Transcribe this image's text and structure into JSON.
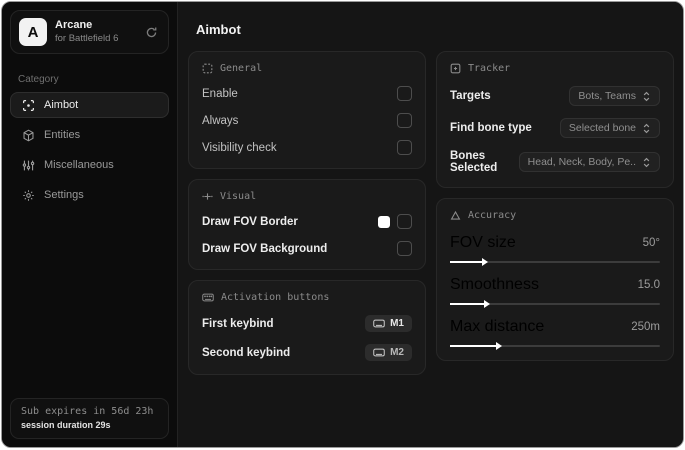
{
  "sidebar": {
    "logo_letter": "A",
    "app_name": "Arcane",
    "app_subtitle": "for Battlefield 6",
    "category_label": "Category",
    "items": [
      {
        "label": "Aimbot",
        "active": true
      },
      {
        "label": "Entities",
        "active": false
      },
      {
        "label": "Miscellaneous",
        "active": false
      },
      {
        "label": "Settings",
        "active": false
      }
    ],
    "subscription": {
      "expires": "Sub expires in 56d 23h",
      "session": "session duration 29s"
    }
  },
  "main": {
    "page_title": "Aimbot",
    "general": {
      "title": "General",
      "rows": [
        {
          "label": "Enable",
          "checked": false
        },
        {
          "label": "Always",
          "checked": false
        },
        {
          "label": "Visibility check",
          "checked": false
        }
      ]
    },
    "visual": {
      "title": "Visual",
      "rows": [
        {
          "label": "Draw FOV Border",
          "checked": false,
          "swatch": "background:#ffffff"
        },
        {
          "label": "Draw FOV Background",
          "checked": false
        }
      ]
    },
    "activation": {
      "title": "Activation buttons",
      "rows": [
        {
          "label": "First keybind",
          "key": "M1"
        },
        {
          "label": "Second keybind",
          "key": "M2"
        }
      ]
    },
    "tracker": {
      "title": "Tracker",
      "rows": [
        {
          "label": "Targets",
          "value": "Bots, Teams"
        },
        {
          "label": "Find bone type",
          "value": "Selected bone"
        },
        {
          "label": "Bones Selected",
          "value": "Head, Neck, Body, Pe.."
        }
      ]
    },
    "accuracy": {
      "title": "Accuracy",
      "rows": [
        {
          "label": "FOV size",
          "value": "50°",
          "fill": "width:15%"
        },
        {
          "label": "Smoothness",
          "value": "15.0",
          "fill": "width:16%"
        },
        {
          "label": "Max distance",
          "value": "250m",
          "fill": "width:22%"
        }
      ]
    }
  },
  "colors": {
    "card_bg": "#1a1a1a",
    "sidebar_bg": "#0c0c0c",
    "main_bg": "#151515",
    "accent": "#ffffff"
  }
}
